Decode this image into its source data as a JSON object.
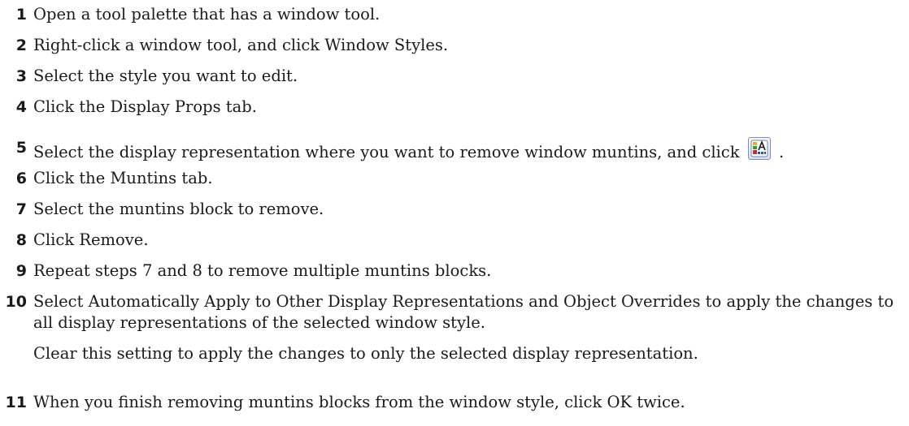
{
  "steps": [
    {
      "number": "1",
      "text": "Open a tool palette that has a window tool."
    },
    {
      "number": "2",
      "text": "Right-click a window tool, and click Window Styles."
    },
    {
      "number": "3",
      "text": "Select the style you want to edit."
    },
    {
      "number": "4",
      "text": "Click the Display Props tab."
    },
    {
      "number": "5",
      "text": "Select the display representation where you want to remove window muntins, and click",
      "text_after": ".",
      "icon": "edit-display-properties-icon"
    },
    {
      "number": "6",
      "text": "Click the Muntins tab."
    },
    {
      "number": "7",
      "text": "Select the muntins block to remove."
    },
    {
      "number": "8",
      "text": "Click Remove."
    },
    {
      "number": "9",
      "text": "Repeat steps 7 and 8 to remove multiple muntins blocks."
    },
    {
      "number": "10",
      "text": "Select Automatically Apply to Other Display Representations and Object Overrides to apply the changes to all display representations of the selected window style.",
      "note": "Clear this setting to apply the changes to only the selected display representation."
    },
    {
      "number": "11",
      "text": "When you finish removing muntins blocks from the window style, click OK twice."
    }
  ]
}
